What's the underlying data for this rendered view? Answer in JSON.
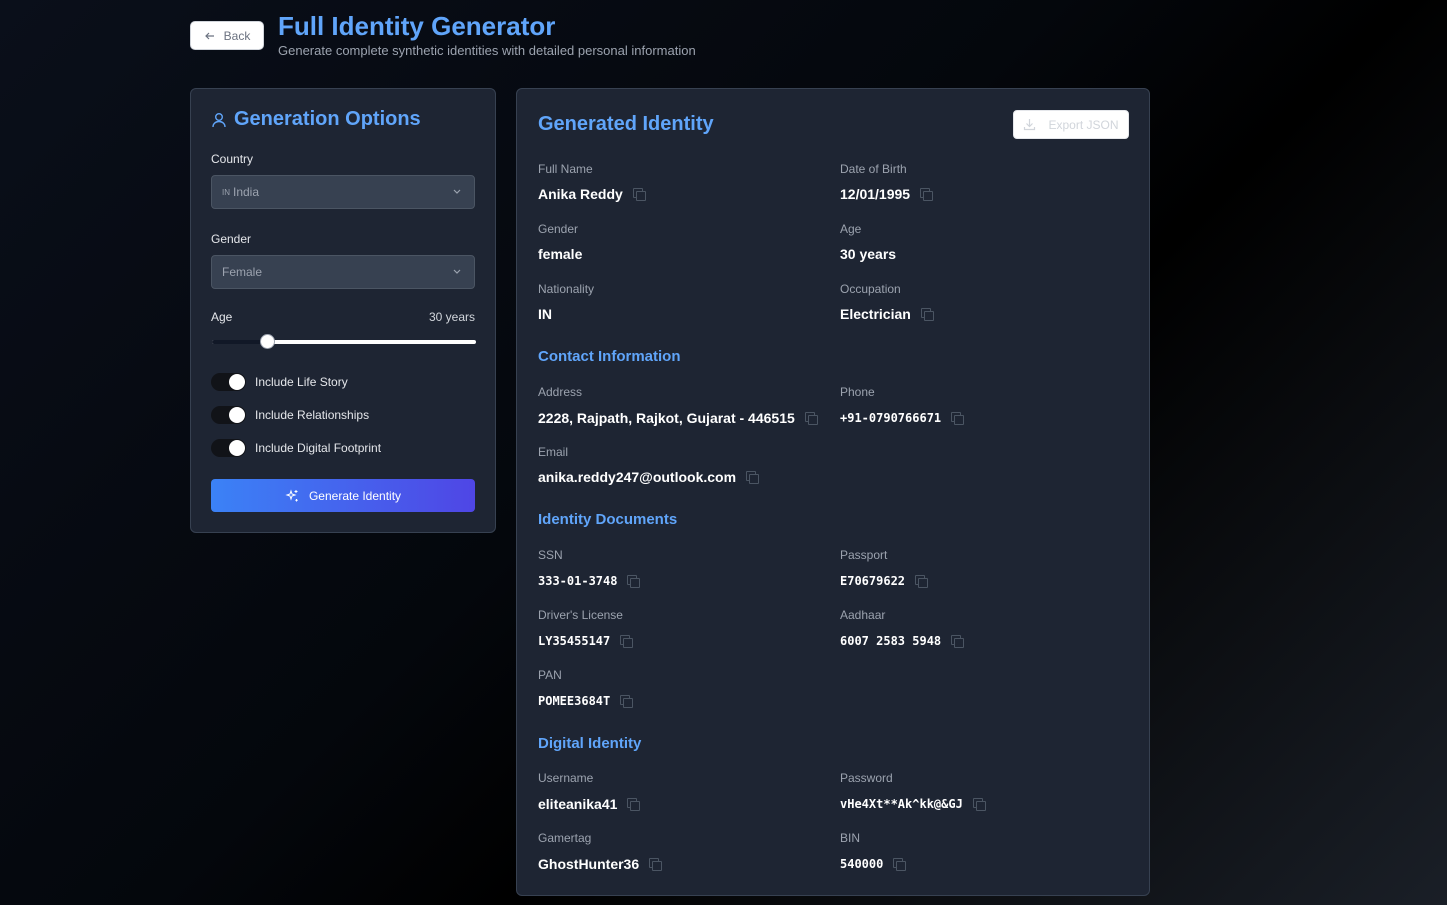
{
  "header": {
    "back_label": "Back",
    "title": "Full Identity Generator",
    "subtitle": "Generate complete synthetic identities with detailed personal information"
  },
  "options": {
    "title": "Generation Options",
    "country_label": "Country",
    "country_flag": "IN",
    "country_value": "India",
    "gender_label": "Gender",
    "gender_value": "Female",
    "age_label": "Age",
    "age_value": "30 years",
    "age_slider_fraction": 0.21,
    "toggles": [
      {
        "label": "Include Life Story",
        "on": true
      },
      {
        "label": "Include Relationships",
        "on": true
      },
      {
        "label": "Include Digital Footprint",
        "on": true
      }
    ],
    "generate_label": "Generate Identity"
  },
  "identity": {
    "title": "Generated Identity",
    "export_label": "Export JSON",
    "personal": {
      "full_name_label": "Full Name",
      "full_name": "Anika Reddy",
      "dob_label": "Date of Birth",
      "dob": "12/01/1995",
      "gender_label": "Gender",
      "gender": "female",
      "age_label": "Age",
      "age": "30 years",
      "nationality_label": "Nationality",
      "nationality": "IN",
      "occupation_label": "Occupation",
      "occupation": "Electrician"
    },
    "contact": {
      "title": "Contact Information",
      "address_label": "Address",
      "address": "2228, Rajpath, Rajkot, Gujarat - 446515",
      "phone_label": "Phone",
      "phone": "+91-0790766671",
      "email_label": "Email",
      "email": "anika.reddy247@outlook.com"
    },
    "documents": {
      "title": "Identity Documents",
      "ssn_label": "SSN",
      "ssn": "333-01-3748",
      "passport_label": "Passport",
      "passport": "E70679622",
      "license_label": "Driver's License",
      "license": "LY35455147",
      "aadhaar_label": "Aadhaar",
      "aadhaar": "6007 2583 5948",
      "pan_label": "PAN",
      "pan": "POMEE3684T"
    },
    "digital": {
      "title": "Digital Identity",
      "username_label": "Username",
      "username": "eliteanika41",
      "password_label": "Password",
      "password": "vHe4Xt**Ak^kk@&GJ",
      "gamertag_label": "Gamertag",
      "gamertag": "GhostHunter36",
      "bin_label": "BIN",
      "bin": "540000"
    }
  },
  "colors": {
    "accent": "#60a5fa",
    "card_bg": "#1e2533",
    "button_gradient_start": "#3b82f6",
    "button_gradient_end": "#4f46e5"
  }
}
